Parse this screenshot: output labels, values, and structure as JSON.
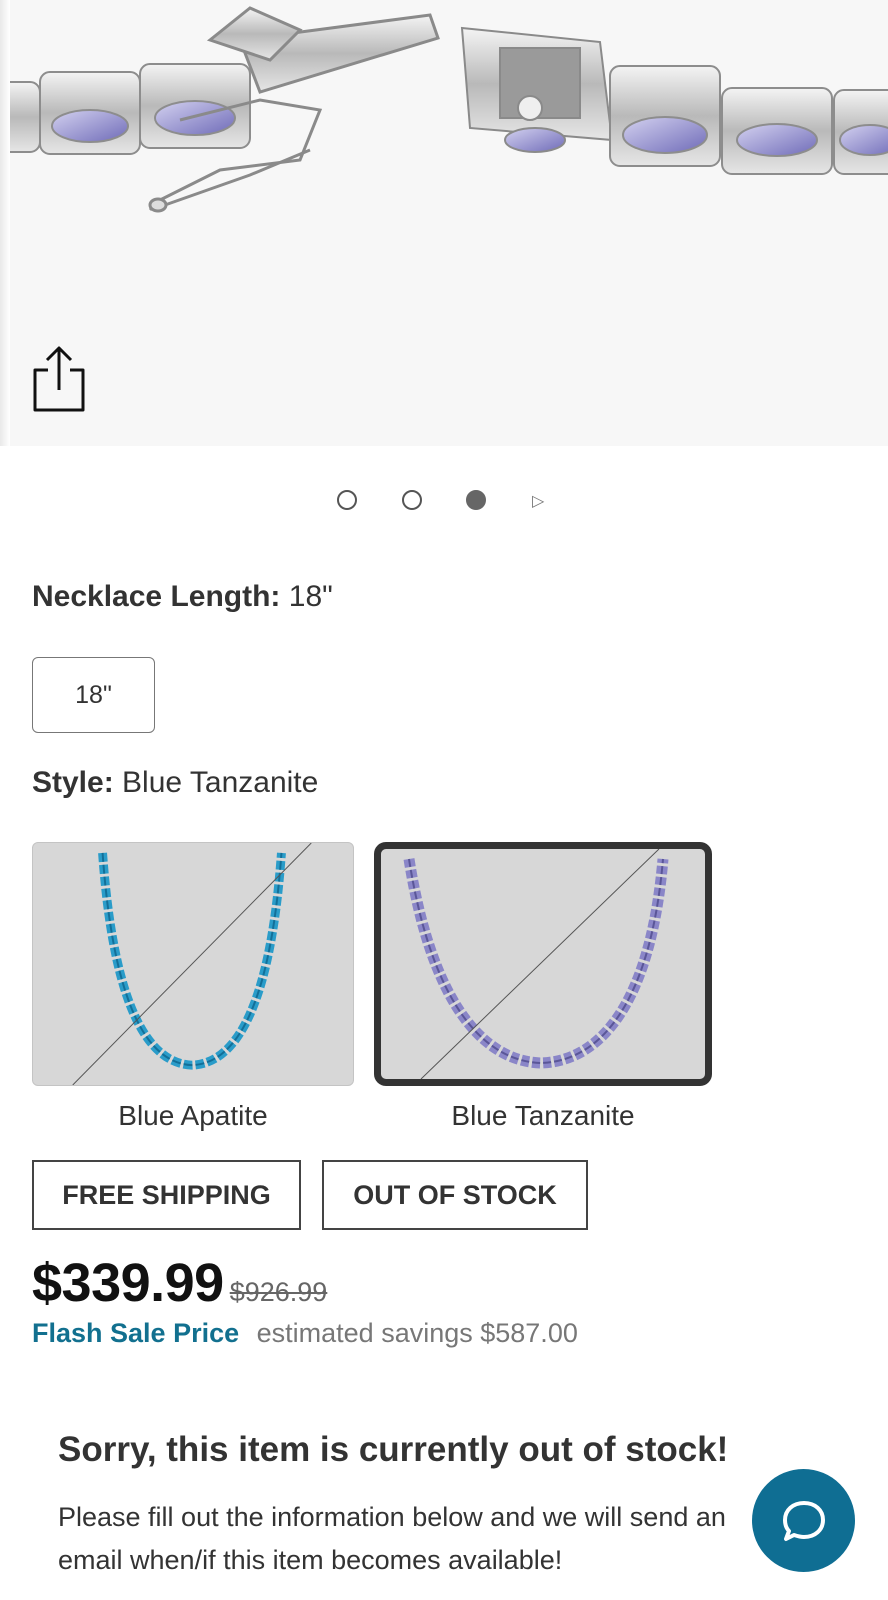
{
  "gallery": {
    "share_icon": "share-icon",
    "dots_total": 3,
    "dots_active_index": 2,
    "next_icon": "play-next-icon"
  },
  "options": {
    "necklace_length": {
      "label": "Necklace Length:",
      "value": "18\"",
      "choices": [
        "18\""
      ]
    },
    "style": {
      "label": "Style:",
      "value": "Blue Tanzanite",
      "choices": [
        {
          "name": "Blue Apatite",
          "color": "#2a9cc9"
        },
        {
          "name": "Blue Tanzanite",
          "color": "#8a86c8",
          "selected": true
        }
      ]
    }
  },
  "badges": [
    "FREE SHIPPING",
    "OUT OF STOCK"
  ],
  "pricing": {
    "price": "$339.99",
    "original_price": "$926.99",
    "sale_label": "Flash Sale Price",
    "savings_text": "estimated savings $587.00"
  },
  "out_of_stock": {
    "title": "Sorry, this item is currently out of stock!",
    "message": "Please fill out the information below and we will send an email when/if this item becomes available!"
  },
  "chat": {
    "icon": "chat-bubble-icon",
    "color": "#0f6e93"
  },
  "colors": {
    "accent": "#12708f",
    "text": "#333333",
    "swatch_bg": "#d7d7d7"
  }
}
